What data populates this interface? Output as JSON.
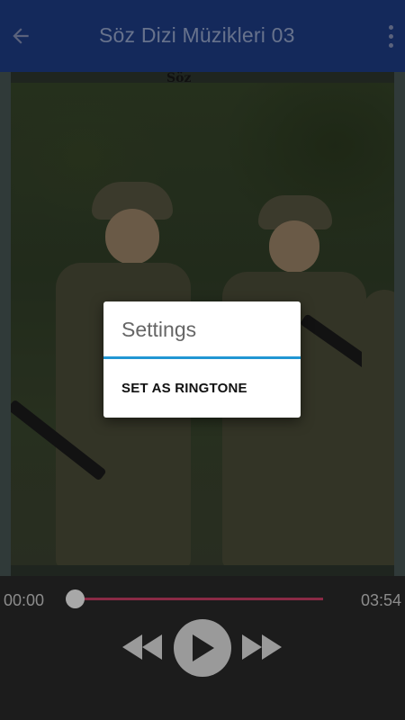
{
  "appbar": {
    "title": "Söz Dizi Müzikleri 03",
    "back_icon": "arrow-left-icon",
    "menu_icon": "more-vert-icon"
  },
  "artwork": {
    "watermark": "Söz"
  },
  "dialog": {
    "title": "Settings",
    "items": [
      {
        "label": "SET AS RINGTONE"
      }
    ]
  },
  "player": {
    "current_time": "00:00",
    "total_time": "03:54",
    "progress": 0,
    "controls": [
      "rewind-icon",
      "play-icon",
      "fast-forward-icon"
    ]
  },
  "colors": {
    "appbar": "#1f3f8c",
    "accent_divider": "#2196d3",
    "seek_track": "#8a2a45",
    "player_bg": "#1c1c1c"
  }
}
